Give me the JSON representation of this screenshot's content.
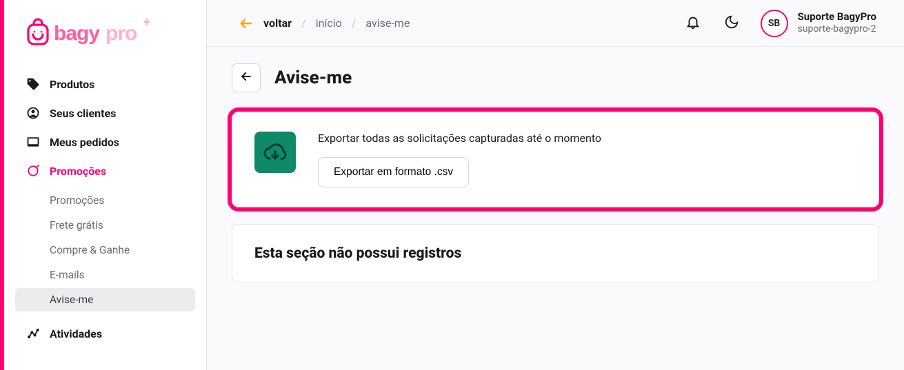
{
  "brand": {
    "name": "bagypro"
  },
  "sidebar": {
    "items": [
      {
        "label": "Produtos"
      },
      {
        "label": "Seus clientes"
      },
      {
        "label": "Meus pedidos"
      },
      {
        "label": "Promoções"
      },
      {
        "label": "Atividades"
      }
    ],
    "promo_sub": [
      {
        "label": "Promoções"
      },
      {
        "label": "Frete grátis"
      },
      {
        "label": "Compre & Ganhe"
      },
      {
        "label": "E-mails"
      },
      {
        "label": "Avise-me"
      }
    ]
  },
  "topbar": {
    "back_label": "voltar",
    "crumb_home": "início",
    "crumb_current": "avise-me",
    "user": {
      "initials": "SB",
      "name": "Suporte BagyPro",
      "slug": "suporte-bagypro-2"
    }
  },
  "page": {
    "title": "Avise-me",
    "export": {
      "description": "Exportar todas as solicitações capturadas até o momento",
      "button_label": "Exportar em formato .csv"
    },
    "empty_message": "Esta seção não possui registros"
  },
  "colors": {
    "accent": "#ff0073",
    "export_bg": "#0f8a68"
  }
}
